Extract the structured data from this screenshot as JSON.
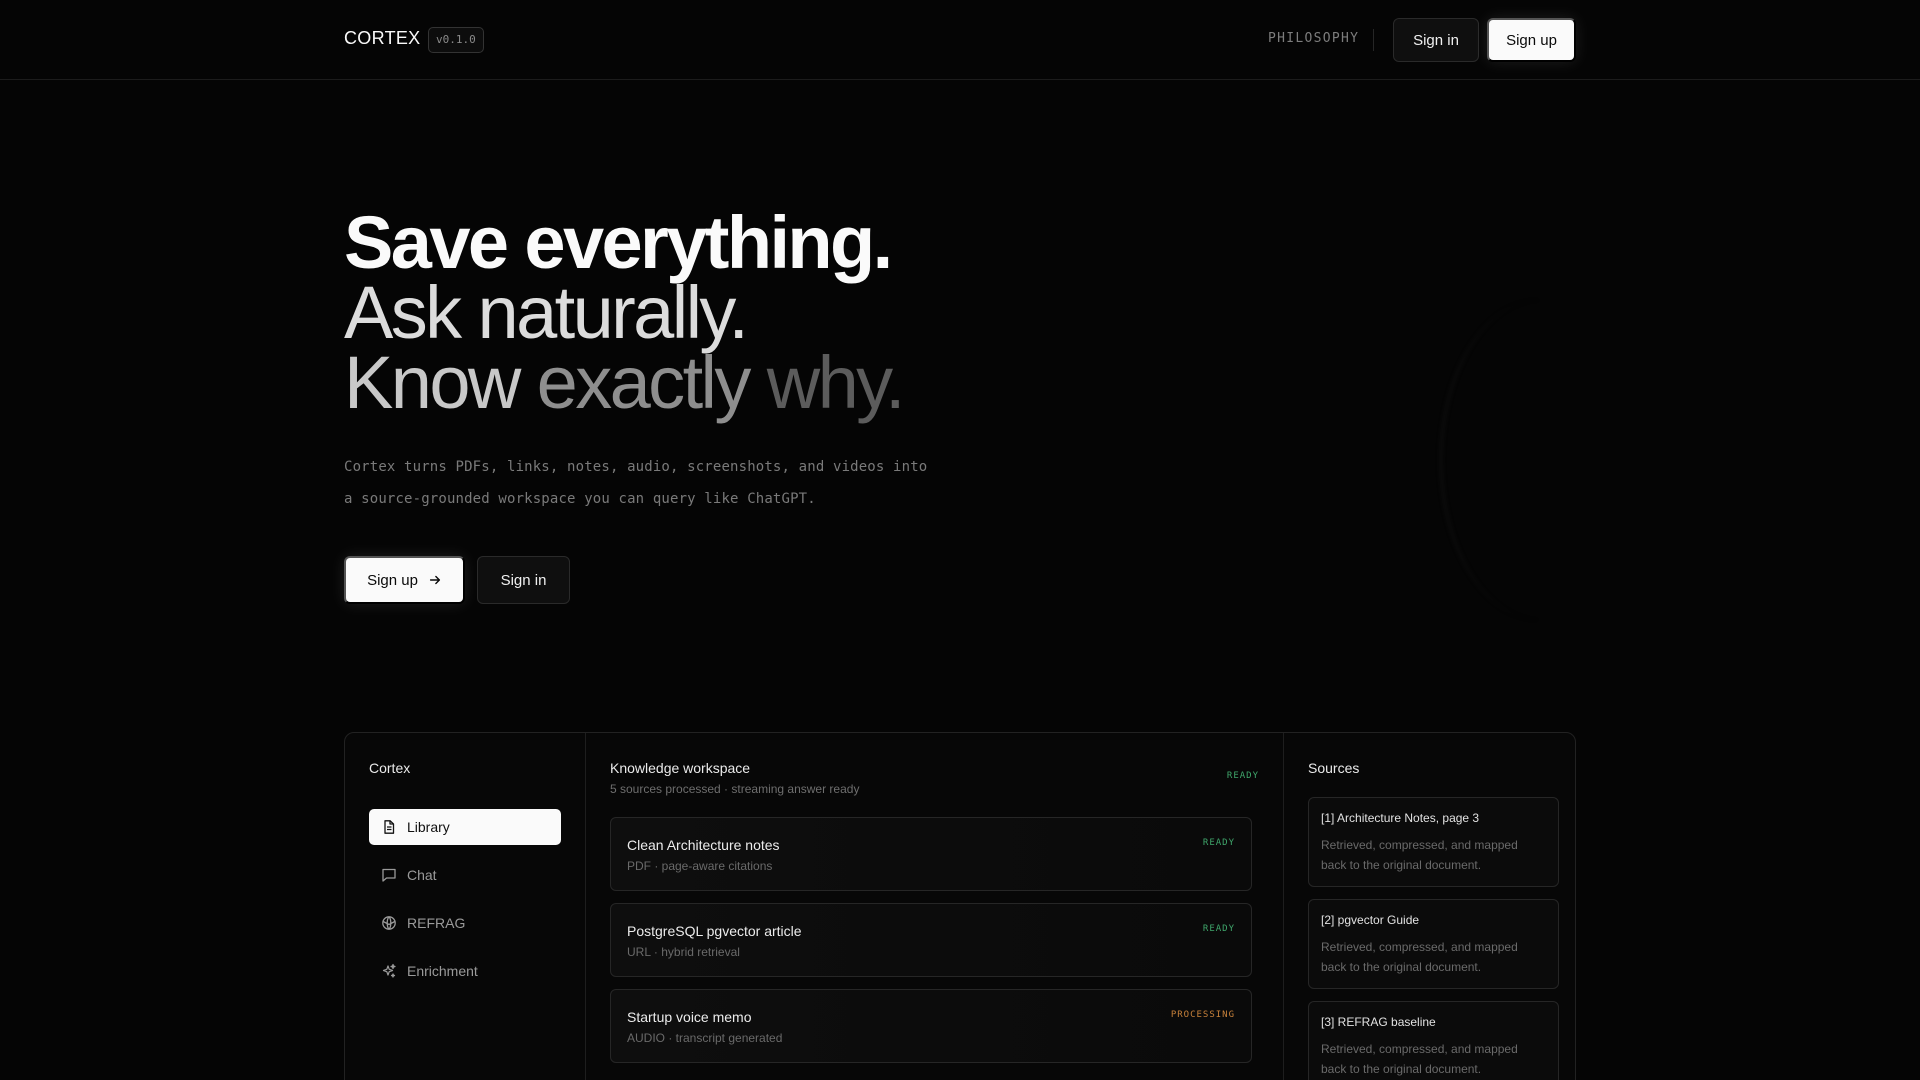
{
  "nav": {
    "brand": "CORTEX",
    "version": "v0.1.0",
    "link": "PHILOSOPHY",
    "signin_label": "Sign in",
    "signup_label": "Sign up"
  },
  "hero": {
    "line1": "Save everything.",
    "line2": "Ask naturally.",
    "line3_a": "Know ",
    "line3_b": "exactly",
    "line3_c": " why.",
    "desc1": "Cortex turns PDFs, links, notes, audio, screenshots, and videos into",
    "desc2": "a source-grounded workspace you can query like ChatGPT.",
    "signup_label": "Sign up",
    "signin_label": "Sign in"
  },
  "app": {
    "sidebar": {
      "title": "Cortex",
      "items": [
        {
          "label": "Library",
          "icon": "document-icon",
          "active": true
        },
        {
          "label": "Chat",
          "icon": "chat-icon"
        },
        {
          "label": "REFRAG",
          "icon": "globe-icon"
        },
        {
          "label": "Enrichment",
          "icon": "sparkles-icon"
        }
      ]
    },
    "main": {
      "title": "Knowledge workspace",
      "subtitle": "5 sources processed · streaming answer ready",
      "status": "READY",
      "cards": [
        {
          "title": "Clean Architecture notes",
          "meta": "PDF · page-aware citations",
          "status": "READY"
        },
        {
          "title": "PostgreSQL pgvector article",
          "meta": "URL · hybrid retrieval",
          "status": "READY"
        },
        {
          "title": "Startup voice memo",
          "meta": "AUDIO · transcript generated",
          "status": "PROCESSING"
        }
      ]
    },
    "sources": {
      "title": "Sources",
      "items": [
        {
          "head": "[1] Architecture Notes, page 3",
          "body": "Retrieved, compressed, and mapped back to the original document."
        },
        {
          "head": "[2] pgvector Guide",
          "body": "Retrieved, compressed, and mapped back to the original document."
        },
        {
          "head": "[3] REFRAG baseline",
          "body": "Retrieved, compressed, and mapped back to the original document."
        }
      ]
    }
  },
  "colors": {
    "background": "#050505",
    "ready": "#3fa66b",
    "processing": "#c7813a"
  }
}
